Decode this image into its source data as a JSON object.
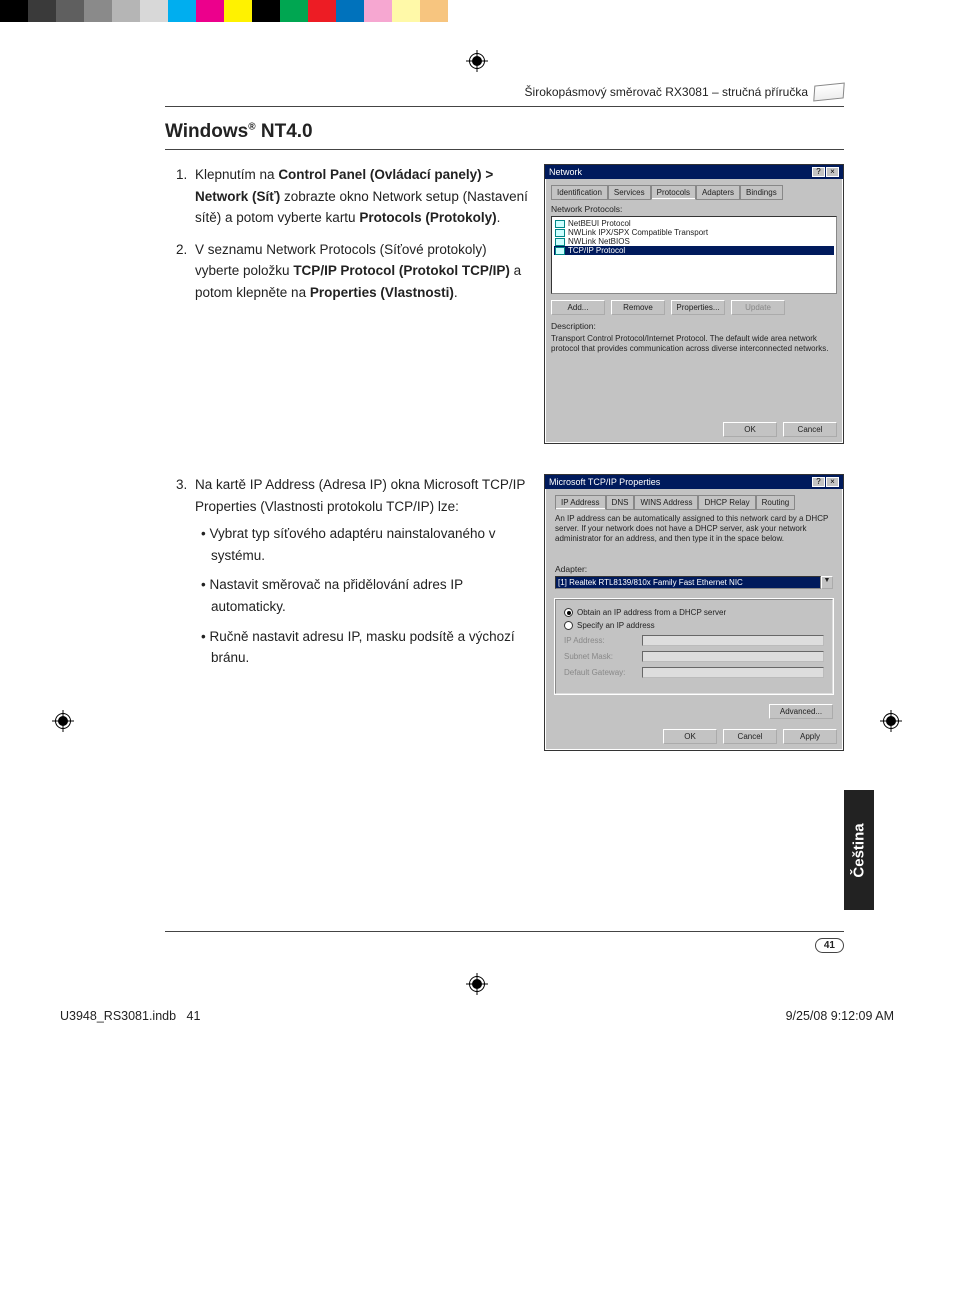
{
  "print_bar_colors_left": [
    "#000",
    "#3a3a3a",
    "#5f5f5f",
    "#8a8a8a",
    "#b5b5b5",
    "#d8d8d8"
  ],
  "print_bar_colors_right": [
    "#00aeef",
    "#ec008c",
    "#fff200",
    "#000",
    "#00a651",
    "#ed1c24",
    "#0072bc",
    "#ec008c",
    "#fff200",
    "#f7941d"
  ],
  "header": {
    "doc_title": "Širokopásmový směrovač RX3081 – stručná příručka"
  },
  "section_title_pre": "Windows",
  "section_title_sup": "®",
  "section_title_post": " NT4.0",
  "steps": {
    "1a": "Klepnutím na ",
    "1b": "Control Panel (Ovládací panely) > Network (Síť)",
    "1c": " zobrazte okno Network setup (Nastavení sítě) a potom vyberte kartu ",
    "1d": "Protocols (Protokoly)",
    "1e": ".",
    "2a": "V seznamu Network Protocols (Síťové protokoly) vyberte položku ",
    "2b": "TCP/IP Protocol (Protokol TCP/IP)",
    "2c": " a potom klepněte na ",
    "2d": "Properties (Vlastnosti)",
    "2e": ".",
    "3": "Na kartě IP Address (Adresa IP) okna Microsoft TCP/IP Properties (Vlastnosti protokolu TCP/IP) lze:",
    "3_bullets": [
      "Vybrat typ síťového adaptéru nainstalovaného v systému.",
      "Nastavit směrovač na přidělování adres IP automaticky.",
      "Ručně nastavit adresu IP, masku podsítě a výchozí bránu."
    ]
  },
  "dialog1": {
    "title": "Network",
    "tabs": [
      "Identification",
      "Services",
      "Protocols",
      "Adapters",
      "Bindings"
    ],
    "list_label": "Network Protocols:",
    "items": [
      "NetBEUI Protocol",
      "NWLink IPX/SPX Compatible Transport",
      "NWLink NetBIOS",
      "TCP/IP Protocol"
    ],
    "buttons": [
      "Add...",
      "Remove",
      "Properties...",
      "Update"
    ],
    "desc_label": "Description:",
    "desc": "Transport Control Protocol/Internet Protocol. The default wide area network protocol that provides communication across diverse interconnected networks.",
    "ok": "OK",
    "cancel": "Cancel"
  },
  "dialog2": {
    "title": "Microsoft TCP/IP Properties",
    "tabs": [
      "IP Address",
      "DNS",
      "WINS Address",
      "DHCP Relay",
      "Routing"
    ],
    "info": "An IP address can be automatically assigned to this network card by a DHCP server. If your network does not have a DHCP server, ask your network administrator for an address, and then type it in the space below.",
    "adapter_label": "Adapter:",
    "adapter_value": "[1] Realtek RTL8139/810x Family Fast Ethernet NIC",
    "radio1": "Obtain an IP address from a DHCP server",
    "radio2": "Specify an IP address",
    "ip_label": "IP Address:",
    "mask_label": "Subnet Mask:",
    "gw_label": "Default Gateway:",
    "advanced": "Advanced...",
    "ok": "OK",
    "cancel": "Cancel",
    "apply": "Apply"
  },
  "side_tab": "Čeština",
  "page_number": "41",
  "footer": {
    "left_file": "U3948_RS3081.indb",
    "left_page": "41",
    "right": "9/25/08   9:12:09 AM"
  }
}
